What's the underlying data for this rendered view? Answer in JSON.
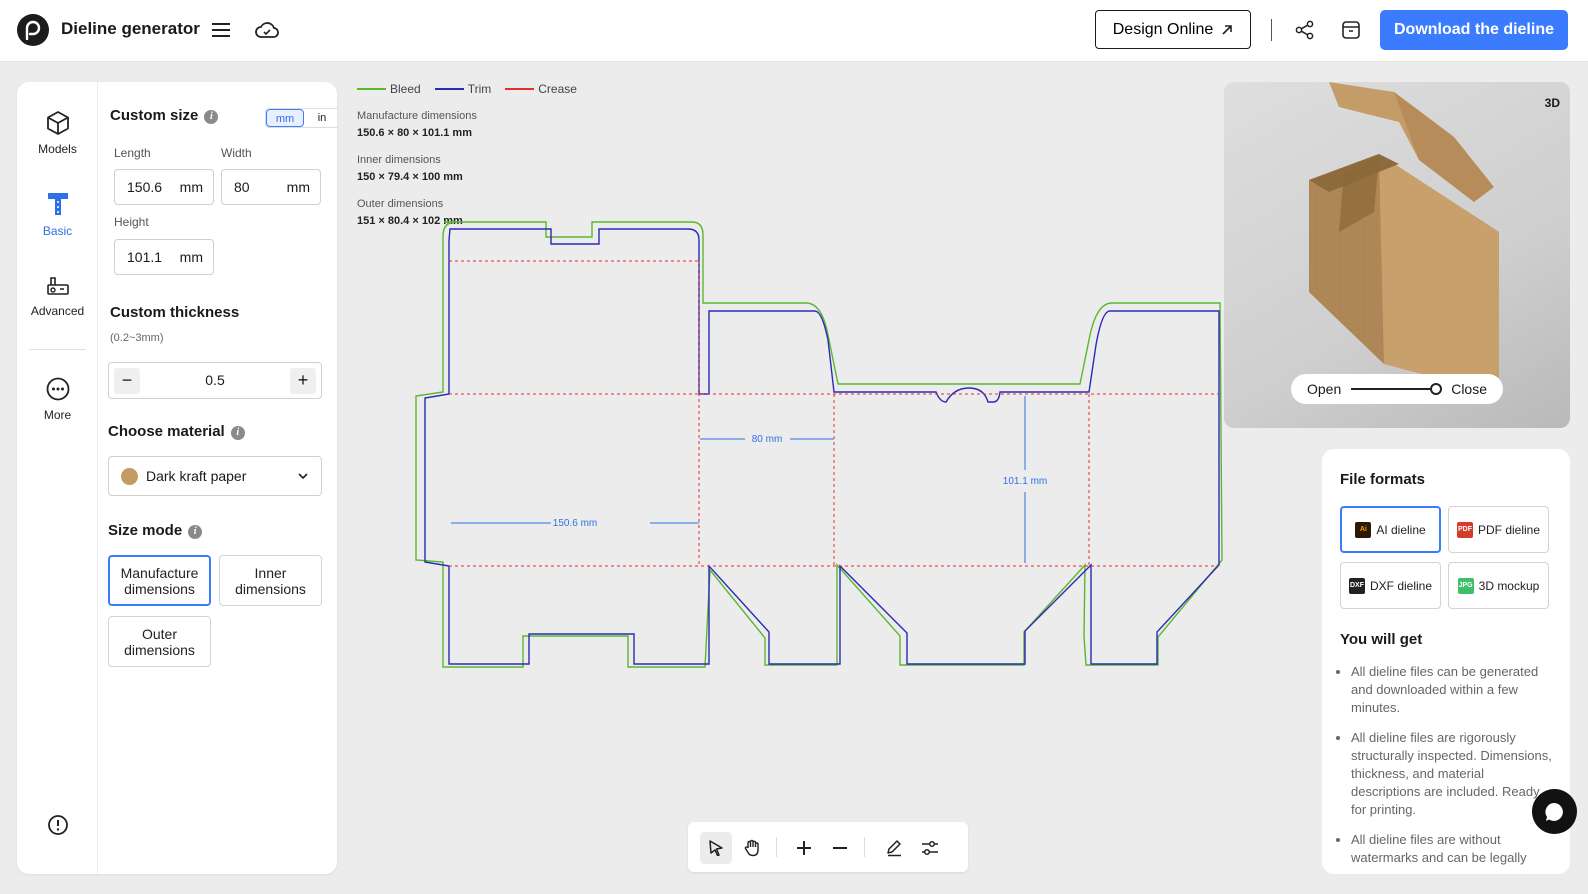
{
  "header": {
    "title": "Dieline generator",
    "design_online": "Design Online",
    "download": "Download the dieline"
  },
  "rail": [
    {
      "label": "Models",
      "icon": "cube-icon"
    },
    {
      "label": "Basic",
      "icon": "ruler-icon"
    },
    {
      "label": "Advanced",
      "icon": "advanced-tools-icon"
    },
    {
      "label": "More",
      "icon": "more-icon"
    }
  ],
  "form": {
    "custom_size": "Custom size",
    "unit_mm": "mm",
    "unit_in": "in",
    "length_label": "Length",
    "length_value": "150.6",
    "width_label": "Width",
    "width_value": "80",
    "height_label": "Height",
    "height_value": "101.1",
    "unit": "mm",
    "thickness_title": "Custom thickness",
    "thickness_hint": "(0.2~3mm)",
    "thickness_value": "0.5",
    "material_title": "Choose material",
    "material_value": "Dark kraft paper",
    "size_mode_title": "Size mode",
    "modes": [
      "Manufacture dimensions",
      "Inner dimensions",
      "Outer dimensions"
    ],
    "selected_mode": "Manufacture dimensions"
  },
  "legend": [
    {
      "label": "Bleed",
      "color": "#5ab82f"
    },
    {
      "label": "Trim",
      "color": "#2b2bb8"
    },
    {
      "label": "Crease",
      "color": "#e03030"
    }
  ],
  "dims": {
    "manufacture_label": "Manufacture dimensions",
    "manufacture_value": "150.6 × 80 × 101.1 mm",
    "inner_label": "Inner dimensions",
    "inner_value": "150 × 79.4 × 100 mm",
    "outer_label": "Outer dimensions",
    "outer_value": "151 × 80.4 × 102 mm"
  },
  "dieline_labels": {
    "length": "150.6 mm",
    "width": "80 mm",
    "height": "101.1 mm"
  },
  "preview": {
    "badge": "3D",
    "open": "Open",
    "close": "Close",
    "slider_value": 0.95
  },
  "files": {
    "title": "File formats",
    "formats": [
      {
        "label": "AI dieline",
        "tag": "Ai",
        "color": "#2a1a06"
      },
      {
        "label": "PDF dieline",
        "tag": "PDF",
        "color": "#d33b2c"
      },
      {
        "label": "DXF dieline",
        "tag": "DXF",
        "color": "#222222"
      },
      {
        "label": "3D mockup",
        "tag": "JPG",
        "color": "#3fbf6a"
      }
    ],
    "you_get": "You will get",
    "bullets": [
      "All dieline files can be generated and downloaded within a few minutes.",
      "All dieline files are rigorously structurally inspected. Dimensions, thickness, and material descriptions are included. Ready for printing.",
      "All dieline files are without watermarks and can be legally"
    ]
  },
  "colors": {
    "accent": "#3b7cff",
    "bleed": "#5ab82f",
    "trim": "#2b2bb8",
    "crease": "#e03030",
    "dim": "#2f6fe8"
  }
}
